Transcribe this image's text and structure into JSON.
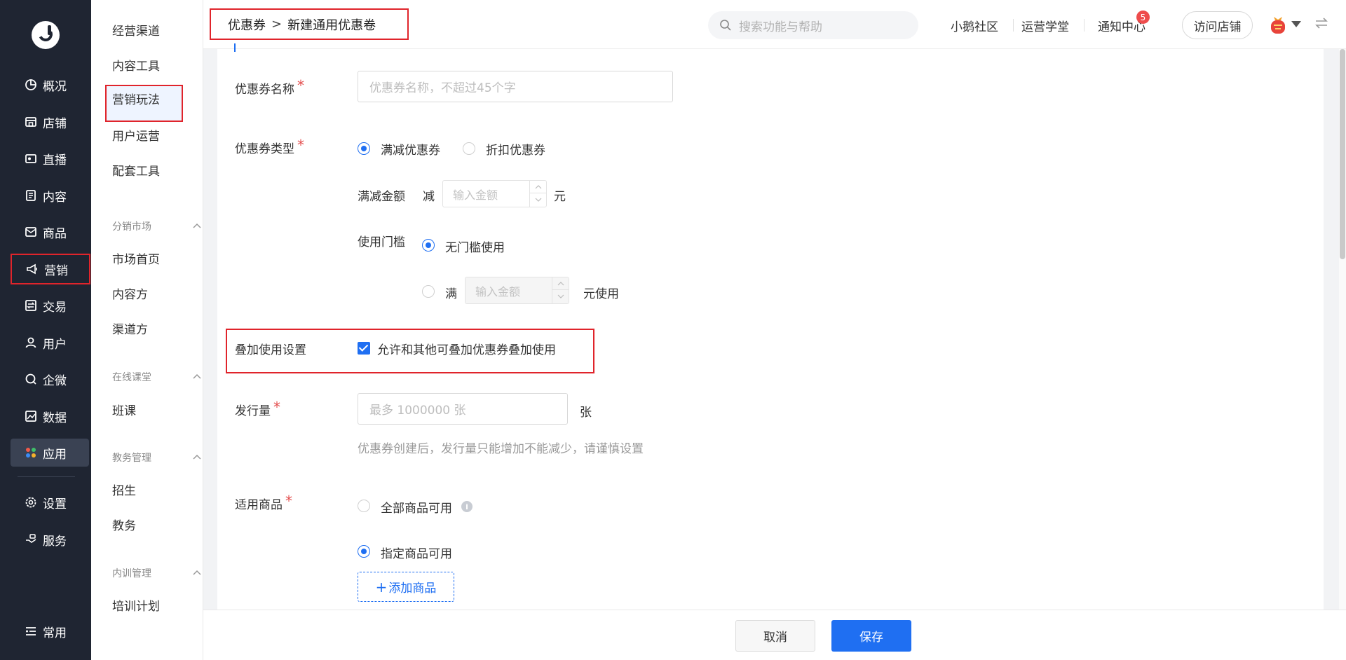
{
  "nav": {
    "items": [
      {
        "label": "概况",
        "icon": "pie-chart-icon"
      },
      {
        "label": "店铺",
        "icon": "store-icon"
      },
      {
        "label": "直播",
        "icon": "live-icon"
      },
      {
        "label": "内容",
        "icon": "document-icon"
      },
      {
        "label": "商品",
        "icon": "bag-icon"
      },
      {
        "label": "营销",
        "icon": "megaphone-icon"
      },
      {
        "label": "交易",
        "icon": "exchange-icon"
      },
      {
        "label": "用户",
        "icon": "user-icon"
      },
      {
        "label": "企微",
        "icon": "chat-icon"
      },
      {
        "label": "数据",
        "icon": "data-icon"
      },
      {
        "label": "应用",
        "icon": "apps-icon"
      },
      {
        "label": "设置",
        "icon": "gear-icon"
      },
      {
        "label": "服务",
        "icon": "service-icon"
      },
      {
        "label": "常用",
        "icon": "list-icon"
      }
    ]
  },
  "submenu": {
    "items": [
      "经营渠道",
      "内容工具",
      "营销玩法",
      "用户运营",
      "配套工具"
    ],
    "groups": [
      {
        "title": "分销市场",
        "items": [
          "市场首页",
          "内容方",
          "渠道方"
        ]
      },
      {
        "title": "在线课堂",
        "items": [
          "班课"
        ]
      },
      {
        "title": "教务管理",
        "items": [
          "招生",
          "教务"
        ]
      },
      {
        "title": "内训管理",
        "items": [
          "培训计划"
        ]
      }
    ]
  },
  "topbar": {
    "breadcrumb_parent": "优惠券",
    "breadcrumb_sep": ">",
    "breadcrumb_current": "新建通用优惠卷",
    "search_placeholder": "搜索功能与帮助",
    "links": [
      "小鹅社区",
      "运营学堂",
      "通知中心"
    ],
    "notification_count": "5",
    "visit_store": "访问店铺"
  },
  "form": {
    "coupon_name": {
      "label": "优惠券名称",
      "required": "*",
      "placeholder": "优惠券名称，不超过45个字"
    },
    "coupon_type": {
      "label": "优惠券类型",
      "required": "*",
      "options": [
        "满减优惠券",
        "折扣优惠券"
      ],
      "selected": "满减优惠券"
    },
    "discount_amount": {
      "label": "满减金额",
      "prefix": "减",
      "placeholder": "输入金额",
      "suffix": "元"
    },
    "threshold": {
      "label": "使用门槛",
      "no_threshold": "无门槛使用",
      "full_prefix": "满",
      "placeholder": "输入金额",
      "full_suffix": "元使用"
    },
    "stacking": {
      "label": "叠加使用设置",
      "checkbox_label": "允许和其他可叠加优惠券叠加使用",
      "checked": true
    },
    "issue_quantity": {
      "label": "发行量",
      "required": "*",
      "placeholder": "最多 1000000 张",
      "unit": "张",
      "hint": "优惠券创建后，发行量只能增加不能减少，请谨慎设置"
    },
    "applicable_goods": {
      "label": "适用商品",
      "required": "*",
      "options": [
        "全部商品可用",
        "指定商品可用"
      ],
      "selected": "指定商品可用",
      "info_glyph": "i",
      "add_button": "添加商品",
      "add_plus": "+"
    }
  },
  "footer": {
    "cancel": "取消",
    "save": "保存"
  },
  "colors": {
    "primary": "#1f6ff2",
    "highlight_box": "#e0242b",
    "nav_bg": "#1f2532"
  }
}
